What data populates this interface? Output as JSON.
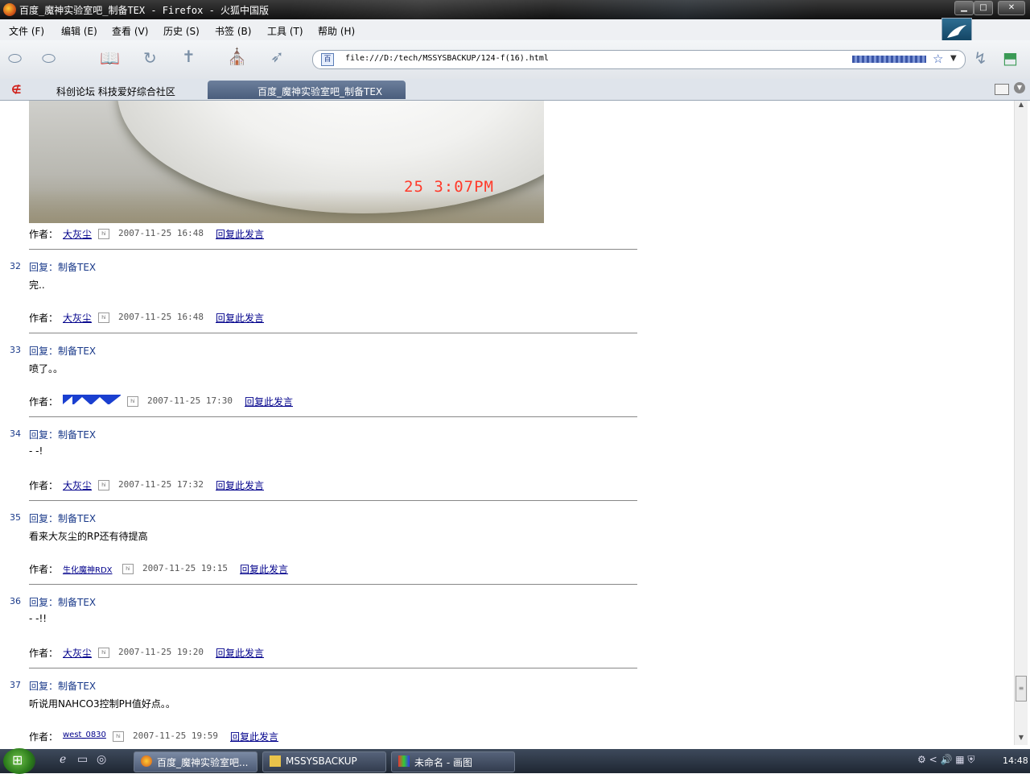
{
  "window": {
    "title": "百度_魔神实验室吧_制备TEX - Firefox - 火狐中国版",
    "controls": {
      "minimize": "▁",
      "maximize": "□",
      "close": "✕"
    }
  },
  "menu": {
    "items": [
      "文件 (F)",
      "编辑 (E)",
      "查看 (V)",
      "历史 (S)",
      "书签 (B)",
      "工具 (T)",
      "帮助 (H)"
    ]
  },
  "toolbar": {
    "icons": [
      "back-icon",
      "forward-icon",
      "bookmarks-icon",
      "reload-icon",
      "cross-icon",
      "church-icon",
      "wing-icon"
    ]
  },
  "urlbar": {
    "url": "file:///D:/tech/MSSYSBACKUP/124-f(16).html",
    "site_icon": "百",
    "star": "☆",
    "dropdown": "▼"
  },
  "tabs": [
    {
      "label": "科创论坛 科技爱好综合社区",
      "active": false
    },
    {
      "label": "百度_魔神实验室吧_制备TEX",
      "active": true
    }
  ],
  "photo": {
    "timestamp_overlay": "25  3:07PM"
  },
  "labels": {
    "author": "作者：",
    "reply_link": "回复此发言",
    "home_icon": "hi"
  },
  "first_meta": {
    "author": "大灰尘",
    "time": "2007-11-25 16:48"
  },
  "posts": [
    {
      "num": "32",
      "title": "回复：制备TEX",
      "body": "完..",
      "author": "大灰尘",
      "time": "2007-11-25 16:48"
    },
    {
      "num": "33",
      "title": "回复：制备TEX",
      "body": "喷了。。",
      "author": "",
      "time": "2007-11-25 17:30"
    },
    {
      "num": "34",
      "title": "回复：制备TEX",
      "body": "- -!",
      "author": "大灰尘",
      "time": "2007-11-25 17:32"
    },
    {
      "num": "35",
      "title": "回复：制备TEX",
      "body": "看来大灰尘的RP还有待提高",
      "author": "生化魔神RDX",
      "time": "2007-11-25 19:15"
    },
    {
      "num": "36",
      "title": "回复：制备TEX",
      "body": "- -!!",
      "author": "大灰尘",
      "time": "2007-11-25 19:20"
    },
    {
      "num": "37",
      "title": "回复：制备TEX",
      "body": "听说用NAHCO3控制PH值好点。。",
      "author": "west_0830",
      "time": "2007-11-25 19:59"
    }
  ],
  "scrollbar": {
    "up": "▲",
    "down": "▼",
    "grip": "≡"
  },
  "taskbar": {
    "start_icon": "windows-logo",
    "tasks": [
      {
        "label": "百度_魔神实验室吧...",
        "icon": "firefox-icon",
        "active": true
      },
      {
        "label": "MSSYSBACKUP",
        "icon": "folder-icon",
        "active": false
      },
      {
        "label": "未命名 - 画图",
        "icon": "paint-icon",
        "active": false
      }
    ],
    "tray": "⚙  <  🔊 ▦ ⛨",
    "clock": "14:48"
  }
}
